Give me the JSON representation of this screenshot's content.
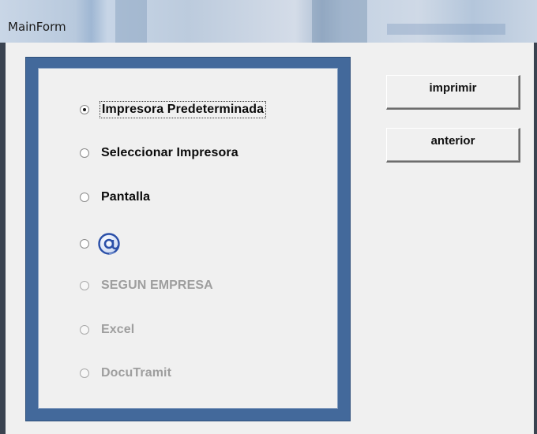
{
  "window": {
    "title": "MainForm"
  },
  "options": [
    {
      "label": "Impresora Predeterminada",
      "checked": true,
      "enabled": true
    },
    {
      "label": "Seleccionar Impresora",
      "checked": false,
      "enabled": true
    },
    {
      "label": "Pantalla",
      "checked": false,
      "enabled": true
    },
    {
      "label": "",
      "icon": "at-sign-icon",
      "checked": false,
      "enabled": true
    },
    {
      "label": "SEGUN EMPRESA",
      "checked": false,
      "enabled": false
    },
    {
      "label": "Excel",
      "checked": false,
      "enabled": false
    },
    {
      "label": "DocuTramit",
      "checked": false,
      "enabled": false
    }
  ],
  "buttons": {
    "print_label": "imprimir",
    "back_label": "anterior"
  },
  "colors": {
    "group_frame": "#43699b",
    "client_bg": "#f0f0f0"
  }
}
